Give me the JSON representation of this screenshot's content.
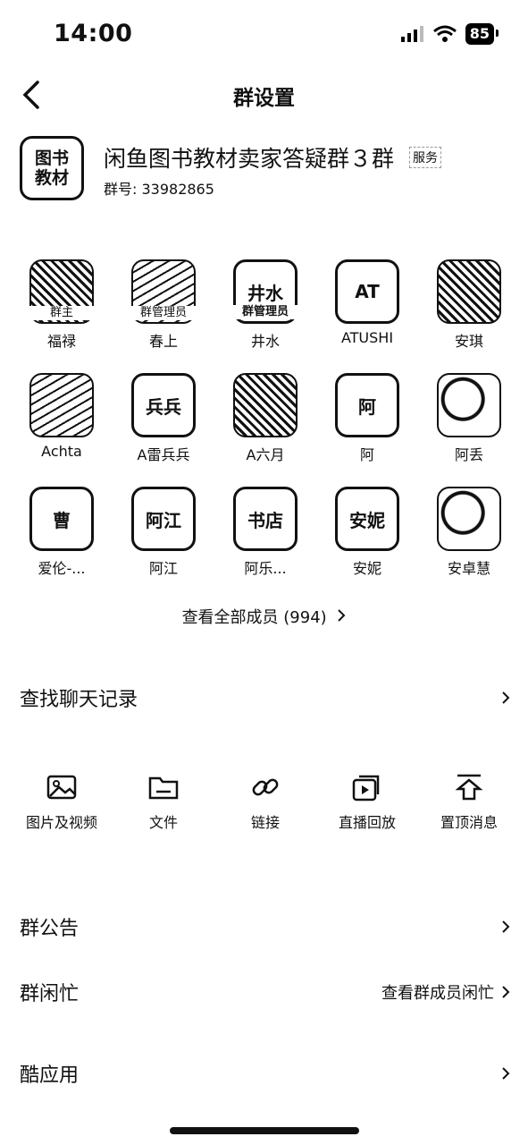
{
  "status": {
    "time": "14:00",
    "battery": "85"
  },
  "nav": {
    "title": "群设置"
  },
  "group": {
    "avatar_line1": "图书",
    "avatar_line2": "教材",
    "name": "闲鱼图书教材卖家答疑群３群",
    "tag": "服务",
    "number": "群号: 33982865"
  },
  "members": [
    [
      {
        "name": "福禄",
        "role": "群主",
        "kind": "pic"
      },
      {
        "name": "春上",
        "role": "群管理员",
        "kind": "pic3"
      },
      {
        "name": "井水",
        "role": "群管理员",
        "kind": "text",
        "avatar_text": "井水"
      },
      {
        "name": "ATUSHI",
        "kind": "text",
        "avatar_text": "AT"
      },
      {
        "name": "安琪",
        "kind": "pic"
      }
    ],
    [
      {
        "name": "Achta",
        "kind": "pic3"
      },
      {
        "name": "A雷兵兵",
        "kind": "text",
        "avatar_text": "兵兵"
      },
      {
        "name": "A六月",
        "kind": "pic"
      },
      {
        "name": "阿",
        "kind": "text",
        "avatar_text": "阿"
      },
      {
        "name": "阿丢",
        "kind": "pic2"
      }
    ],
    [
      {
        "name": "爱伦-...",
        "kind": "text",
        "avatar_text": "曹"
      },
      {
        "name": "阿江",
        "kind": "text",
        "avatar_text": "阿江"
      },
      {
        "name": "阿乐...",
        "kind": "text",
        "avatar_text": "书店"
      },
      {
        "name": "安妮",
        "kind": "text",
        "avatar_text": "安妮"
      },
      {
        "name": "安卓慧",
        "kind": "pic2"
      }
    ]
  ],
  "view_all": "查看全部成员 (994)",
  "search_history": "查找聊天记录",
  "media": [
    "图片及视频",
    "文件",
    "链接",
    "直播回放",
    "置顶消息"
  ],
  "announcement": "群公告",
  "busy": {
    "label": "群闲忙",
    "value": "查看群成员闲忙"
  },
  "apps": "酷应用"
}
